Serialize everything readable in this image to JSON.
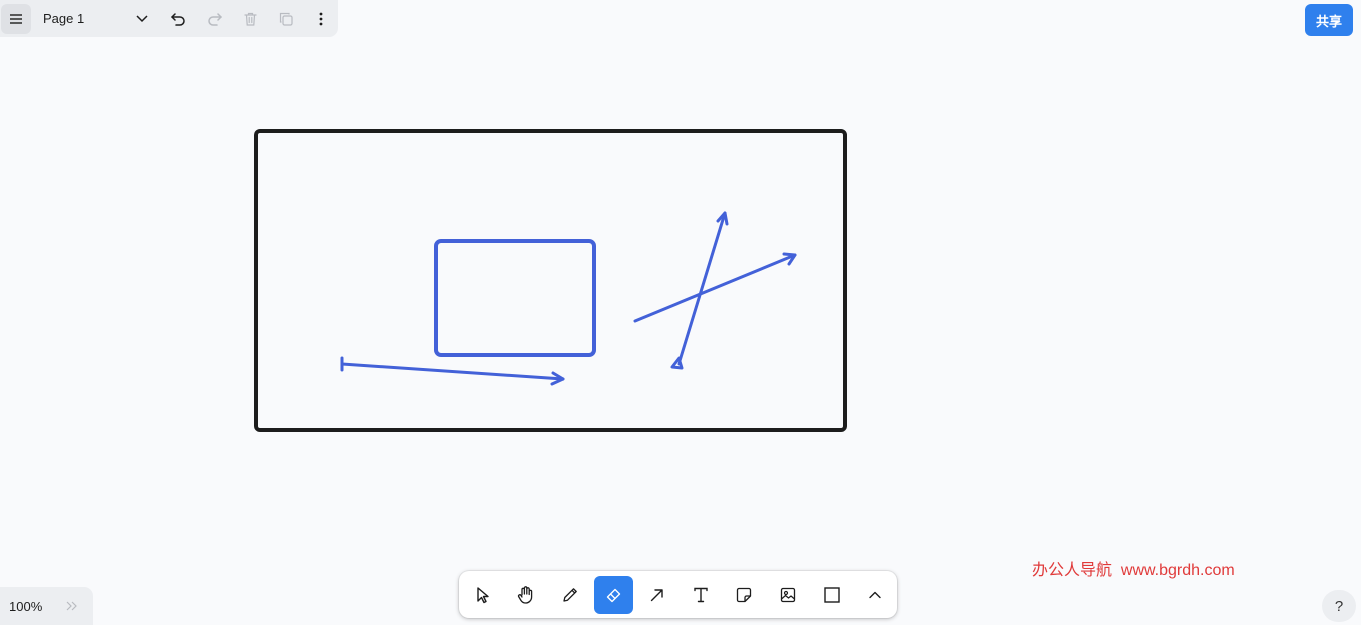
{
  "header": {
    "page_name": "Page 1",
    "share_label": "共享"
  },
  "footer": {
    "zoom": "100%",
    "help": "?",
    "watermark": "办公人导航  www.bgrdh.com"
  },
  "toolbar": {
    "tools": [
      "select-icon",
      "hand-icon",
      "pencil-icon",
      "eraser-icon",
      "arrow-icon",
      "text-icon",
      "note-icon",
      "image-icon",
      "rectangle-icon",
      "chevron-up-icon"
    ],
    "active_tool": "eraser-icon"
  },
  "colors": {
    "accent": "#2f80ed",
    "stroke_black": "#1d1d1d",
    "stroke_blue": "#4361d8",
    "watermark": "#e03a3a"
  }
}
